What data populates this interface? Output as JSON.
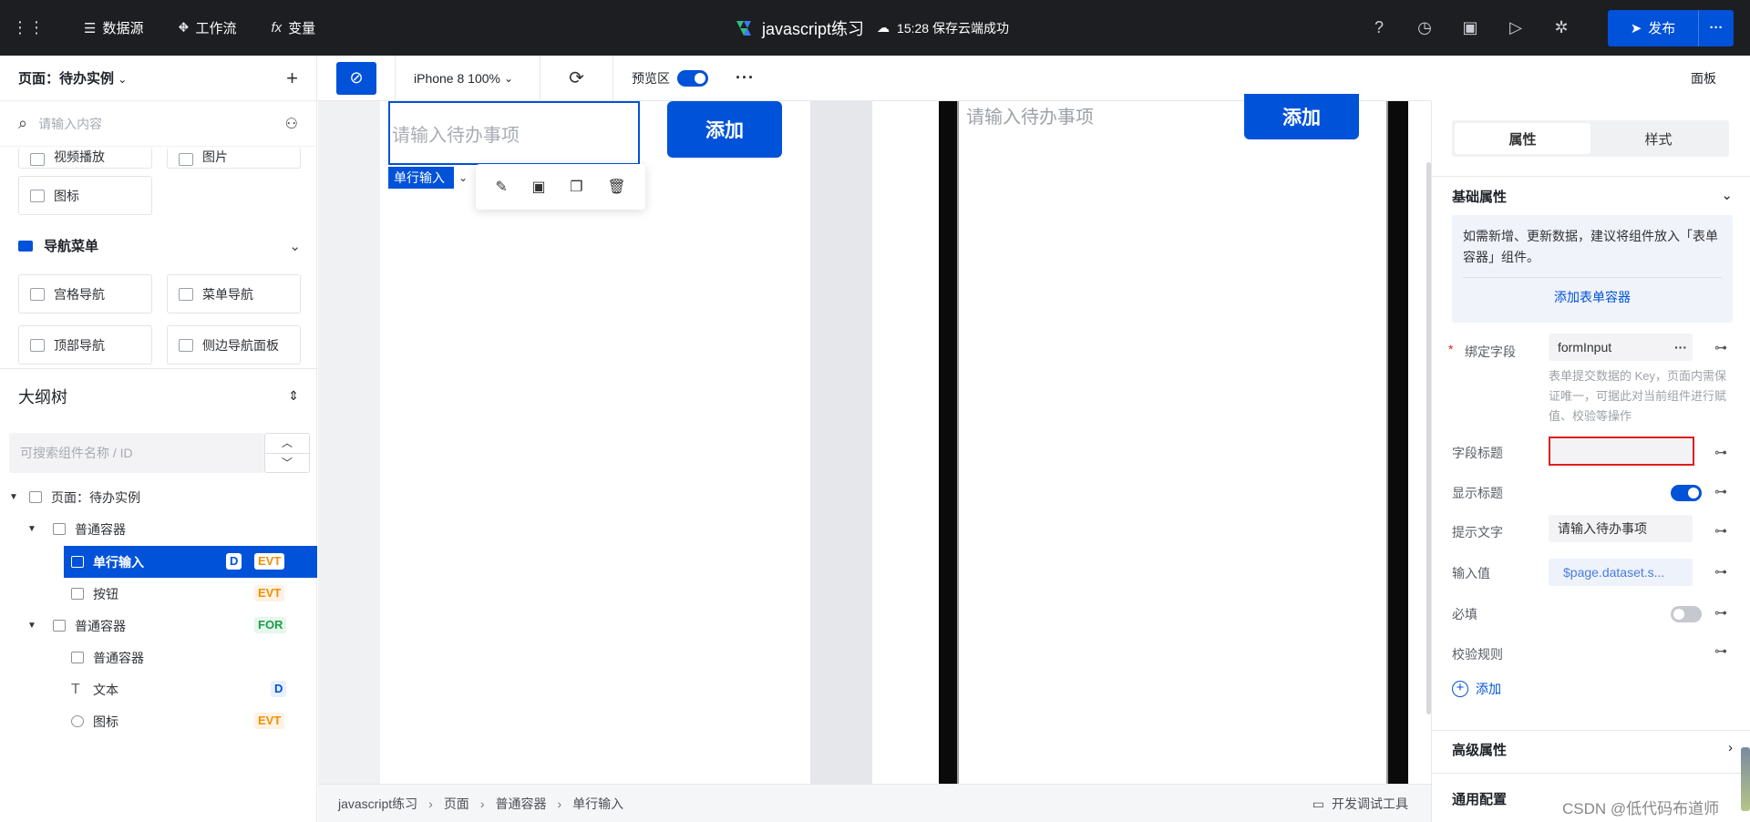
{
  "topbar": {
    "datasource": "数据源",
    "workflow": "工作流",
    "variables": "变量",
    "fx": "fx",
    "app_title": "javascript练习",
    "save_status": "15:28 保存云端成功",
    "publish": "发布",
    "more": "···"
  },
  "left": {
    "page_title": "页面：待办实例",
    "add": "+",
    "search_placeholder": "请输入内容",
    "components_top": [
      {
        "label": "视频播放"
      },
      {
        "label": "图片"
      }
    ],
    "icon_card": "图标",
    "nav_section": "导航菜单",
    "nav_items": [
      "宫格导航",
      "菜单导航",
      "顶部导航",
      "侧边导航面板"
    ],
    "outline_title": "大纲树",
    "outline_search": "可搜索组件名称 / ID",
    "tree": [
      {
        "label": "页面：待办实例",
        "tags": []
      },
      {
        "label": "普通容器",
        "tags": []
      },
      {
        "label": "单行输入",
        "tags": [
          "D",
          "EVT"
        ]
      },
      {
        "label": "按钮",
        "tags": [
          "EVT"
        ]
      },
      {
        "label": "普通容器",
        "tags": [
          "FOR"
        ]
      },
      {
        "label": "普通容器",
        "tags": []
      },
      {
        "label": "文本",
        "tags": [
          "D"
        ]
      },
      {
        "label": "图标",
        "tags": [
          "EVT"
        ]
      }
    ]
  },
  "toolbar": {
    "device": "iPhone 8 100%",
    "preview": "预览区",
    "more": "···",
    "panel": "面板"
  },
  "canvas": {
    "input_placeholder": "请输入待办事项",
    "add_button": "添加",
    "selected_label": "单行输入",
    "preview_input": "请输入待办事项",
    "preview_button": "添加"
  },
  "breadcrumb": [
    "javascript练习",
    "页面",
    "普通容器",
    "单行输入"
  ],
  "devtools": "开发调试工具",
  "right": {
    "tab_props": "属性",
    "tab_style": "样式",
    "basic_props": "基础属性",
    "tip": "如需新增、更新数据，建议将组件放入「表单容器」组件。",
    "tip_link": "添加表单容器",
    "bind_field_label": "绑定字段",
    "bind_field_value": "formInput",
    "bind_help": "表单提交数据的 Key，页面内需保证唯一，可据此对当前组件进行赋值、校验等操作",
    "field_title_label": "字段标题",
    "field_title_value": "",
    "show_title_label": "显示标题",
    "show_title_on": true,
    "hint_label": "提示文字",
    "hint_value": "请输入待办事项",
    "input_value_label": "输入值",
    "input_value": "$page.dataset.s...",
    "required_label": "必填",
    "required_on": false,
    "validation_label": "校验规则",
    "add_rule": "添加",
    "advanced": "高级属性",
    "common": "通用配置"
  },
  "watermark": "CSDN @低代码布道师",
  "colors": {
    "accent": "#0052d9",
    "topbar": "#1d1e22",
    "highlight": "#e01e1e"
  }
}
